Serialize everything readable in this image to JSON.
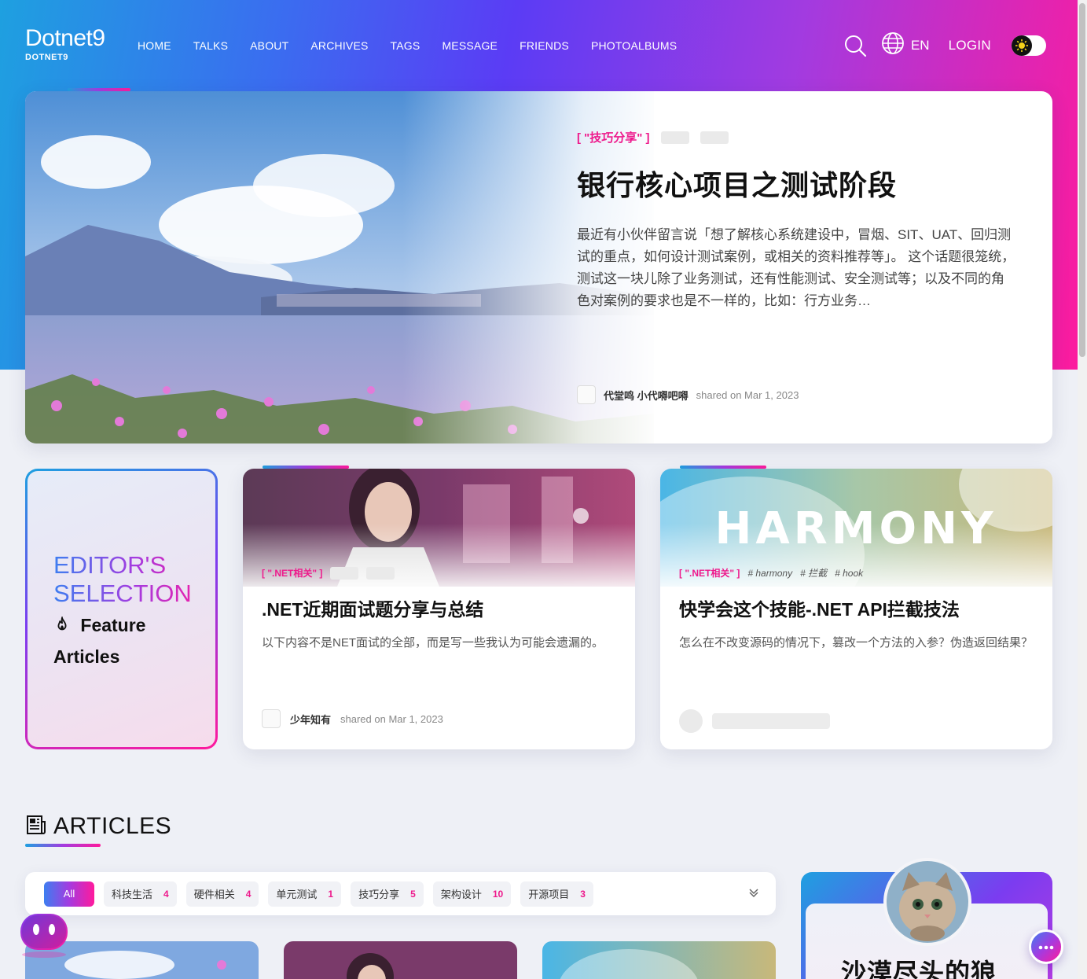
{
  "site": {
    "logo_main": "Dotnet9",
    "logo_sub": "DOTNET9"
  },
  "nav": {
    "items": [
      "HOME",
      "TALKS",
      "ABOUT",
      "ARCHIVES",
      "TAGS",
      "MESSAGE",
      "FRIENDS",
      "PHOTOALBUMS"
    ],
    "language": "EN",
    "login": "LOGIN"
  },
  "featured": {
    "category": "[ \"技巧分享\" ]",
    "title": "银行核心项目之测试阶段",
    "excerpt": "最近有小伙伴留言说「想了解核心系统建设中，冒烟、SIT、UAT、回归测试的重点，如何设计测试案例，或相关的资料推荐等」。 这个话题很笼统，测试这一块儿除了业务测试，还有性能测试、安全测试等；以及不同的角色对案例的要求也是不一样的，比如：行方业务…",
    "author": "代堂鸣 小代嘚吧嘚",
    "date": "shared on Mar 1, 2023"
  },
  "editor": {
    "title_line1": "EDITOR'S",
    "title_line2": "SELECTION",
    "sub_line1": "Feature",
    "sub_line2": "Articles"
  },
  "cards": [
    {
      "category": "[ \".NET相关\" ]",
      "tags": [],
      "title": ".NET近期面试题分享与总结",
      "excerpt": "以下内容不是NET面试的全部，而是写一些我认为可能会遗漏的。",
      "author": "少年知有",
      "date": "shared on Mar 1, 2023"
    },
    {
      "category": "[ \".NET相关\" ]",
      "tags": [
        "# harmony",
        "# 拦截",
        "# hook"
      ],
      "image_text": "HARMONY",
      "title": "快学会这个技能-.NET API拦截技法",
      "excerpt": "怎么在不改变源码的情况下，篡改一个方法的入参？伪造返回结果？"
    }
  ],
  "articles": {
    "heading": "ARTICLES",
    "filters": [
      {
        "label": "All",
        "count": ""
      },
      {
        "label": "科技生活",
        "count": "4"
      },
      {
        "label": "硬件相关",
        "count": "4"
      },
      {
        "label": "单元测试",
        "count": "1"
      },
      {
        "label": "技巧分享",
        "count": "5"
      },
      {
        "label": "架构设计",
        "count": "10"
      },
      {
        "label": "开源项目",
        "count": "3"
      }
    ]
  },
  "profile": {
    "name": "沙漠尽头的狼"
  },
  "colors": {
    "accent_pink": "#ee1a8c",
    "gradient_blue": "#1ea0e0",
    "gradient_purple": "#7b3cf0"
  }
}
